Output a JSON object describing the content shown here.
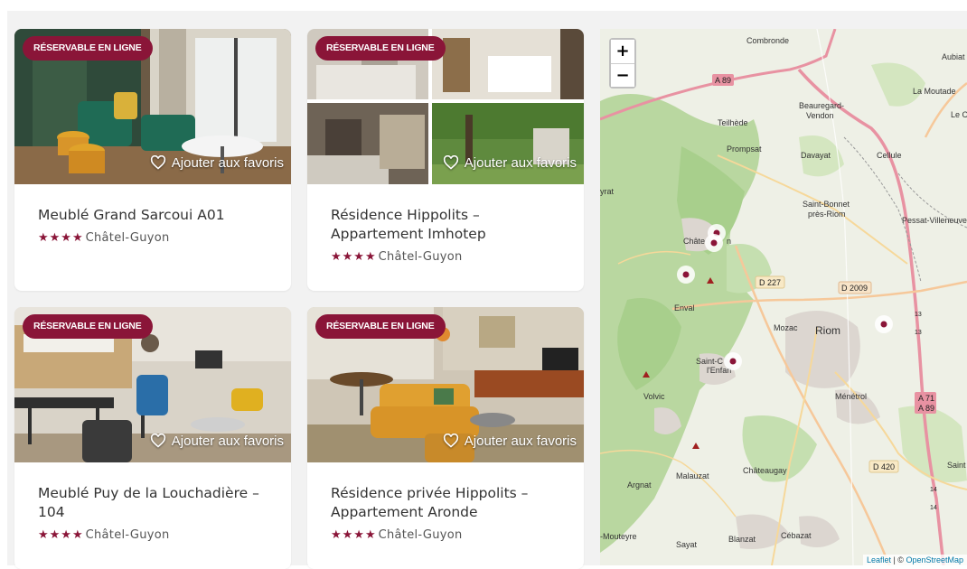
{
  "listings": [
    {
      "badge": "RÉSERVABLE EN LIGNE",
      "favorite_label": "Ajouter aux favoris",
      "title": "Meublé Grand Sarcoui A01",
      "stars": "★★★★",
      "location": "Châtel-Guyon"
    },
    {
      "badge": "RÉSERVABLE EN LIGNE",
      "favorite_label": "Ajouter aux favoris",
      "title": "Résidence Hippolits – Appartement Imhotep",
      "stars": "★★★★",
      "location": "Châtel-Guyon"
    },
    {
      "badge": "RÉSERVABLE EN LIGNE",
      "favorite_label": "Ajouter aux favoris",
      "title": "Meublé Puy de la Louchadière – 104",
      "stars": "★★★★",
      "location": "Châtel-Guyon"
    },
    {
      "badge": "RÉSERVABLE EN LIGNE",
      "favorite_label": "Ajouter aux favoris",
      "title": "Résidence privée Hippolits – Appartement Aronde",
      "stars": "★★★★",
      "location": "Châtel-Guyon"
    }
  ],
  "map": {
    "zoom_in": "+",
    "zoom_out": "−",
    "attribution_leaflet": "Leaflet",
    "attribution_sep": " | © ",
    "attribution_osm": "OpenStreetMap",
    "places": {
      "combronde": "Combronde",
      "aubiat": "Aubiat",
      "la_moutade": "La Moutade",
      "le_ch": "Le Ch",
      "beauregard": "Beauregard-",
      "vendon": "Vendon",
      "teilhede": "Teilhède",
      "prompsat": "Prompsat",
      "davayat": "Davayat",
      "cellule": "Cellule",
      "yrat": "yrat",
      "saint_bonnet": "Saint-Bonnet",
      "pres_riom": "près-Riom",
      "pessat": "Pessat-Villeneuve",
      "chatel": "Châte",
      "chatel_n": "n",
      "enval": "Enval",
      "mozac": "Mozac",
      "riom": "Riom",
      "saint_c": "Saint-C",
      "enfant": "l'Enfan",
      "volvic": "Volvic",
      "menetrol": "Ménétrol",
      "malauzat": "Malauzat",
      "chateaugay": "Châteaugay",
      "argnat": "Argnat",
      "mouteyre": "-Mouteyre",
      "sayat": "Sayat",
      "blanzat": "Blanzat",
      "cebazat": "Cébazat",
      "saint": "Saint"
    },
    "roads": {
      "a89": "A 89",
      "d227": "D 227",
      "d2009": "D 2009",
      "a71": "A 71",
      "a89b": "A 89",
      "d420": "D 420",
      "n13a": "13",
      "n13b": "13",
      "n14a": "14",
      "n14b": "14"
    }
  }
}
